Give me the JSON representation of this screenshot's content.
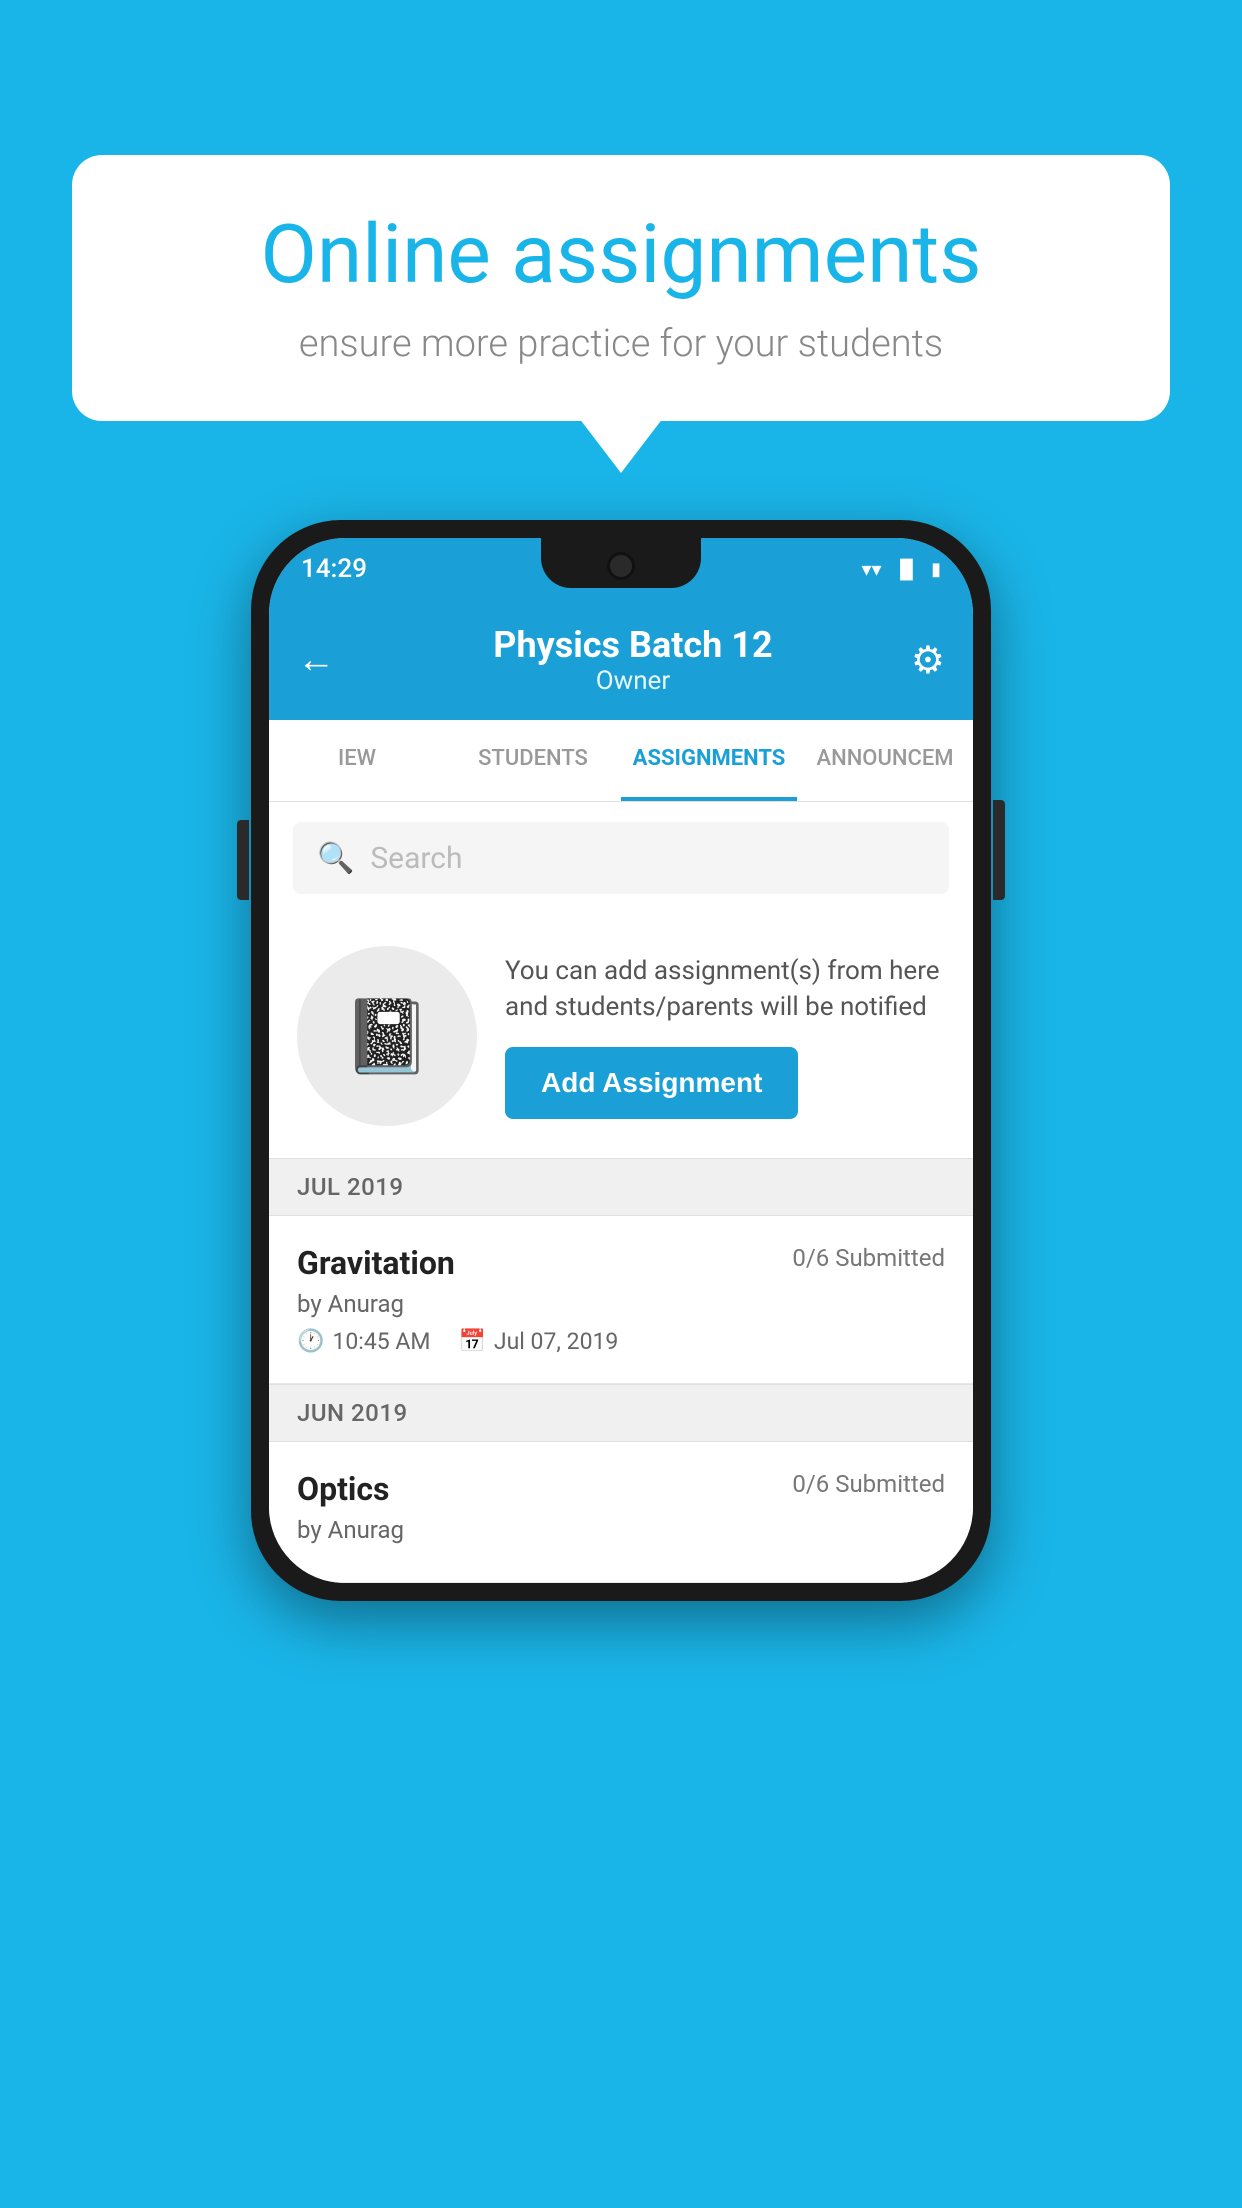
{
  "background_color": "#1ab5e8",
  "speech_bubble": {
    "title": "Online assignments",
    "subtitle": "ensure more practice for your students"
  },
  "status_bar": {
    "time": "14:29",
    "wifi": "▼",
    "signal": "◀",
    "battery": "▮"
  },
  "app_bar": {
    "title": "Physics Batch 12",
    "subtitle": "Owner",
    "back_label": "←",
    "settings_label": "⚙"
  },
  "tabs": [
    {
      "label": "IEW",
      "active": false
    },
    {
      "label": "STUDENTS",
      "active": false
    },
    {
      "label": "ASSIGNMENTS",
      "active": true
    },
    {
      "label": "ANNOUNCEM",
      "active": false
    }
  ],
  "search": {
    "placeholder": "Search"
  },
  "info_section": {
    "description": "You can add assignment(s) from here and students/parents will be notified",
    "button_label": "Add Assignment"
  },
  "sections": [
    {
      "month": "JUL 2019",
      "assignments": [
        {
          "title": "Gravitation",
          "submitted": "0/6 Submitted",
          "author": "by Anurag",
          "time": "10:45 AM",
          "date": "Jul 07, 2019"
        }
      ]
    },
    {
      "month": "JUN 2019",
      "assignments": [
        {
          "title": "Optics",
          "submitted": "0/6 Submitted",
          "author": "by Anurag",
          "time": "",
          "date": ""
        }
      ]
    }
  ]
}
